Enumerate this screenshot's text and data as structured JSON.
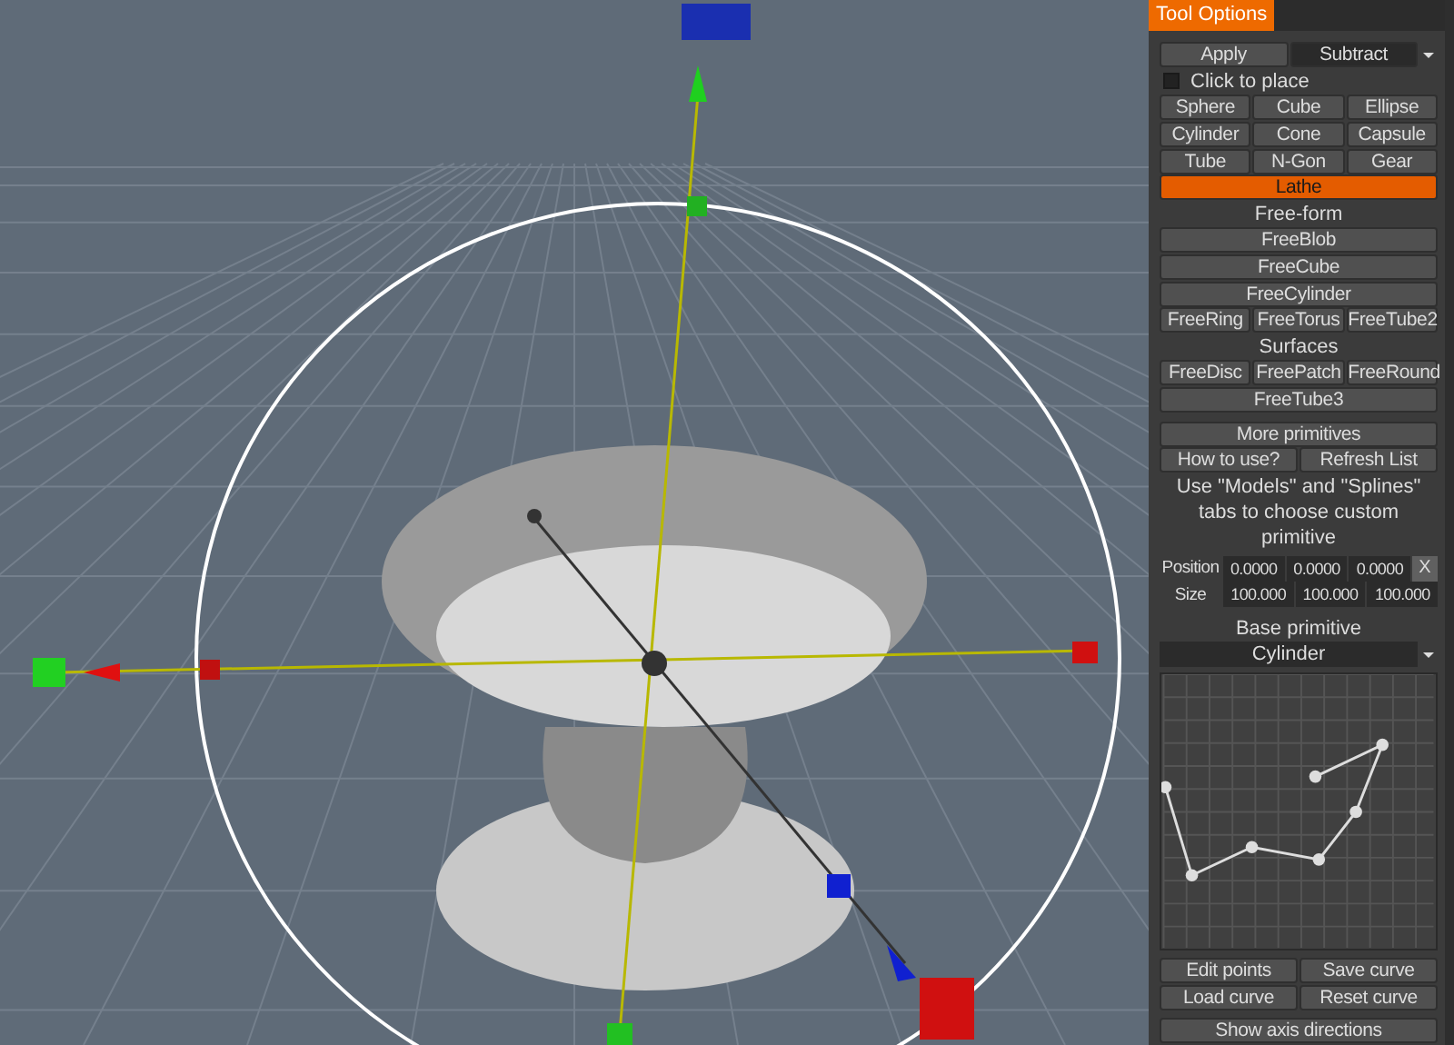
{
  "panel_tab": "Tool Options",
  "mode": {
    "options": [
      {
        "label": "Apply",
        "selected": false
      },
      {
        "label": "Subtract",
        "selected": true
      }
    ]
  },
  "click_to_place": {
    "label": "Click to place",
    "checked": false
  },
  "primitives": [
    {
      "kind": "grid",
      "buttons": [
        {
          "label": "Sphere",
          "selected": false
        },
        {
          "label": "Cube",
          "selected": false
        },
        {
          "label": "Ellipse",
          "selected": false
        }
      ]
    },
    {
      "kind": "grid",
      "buttons": [
        {
          "label": "Cylinder",
          "selected": false
        },
        {
          "label": "Cone",
          "selected": false
        },
        {
          "label": "Capsule",
          "selected": false
        }
      ]
    },
    {
      "kind": "grid",
      "buttons": [
        {
          "label": "Tube",
          "selected": false
        },
        {
          "label": "N-Gon",
          "selected": false
        },
        {
          "label": "Gear",
          "selected": false
        }
      ]
    },
    {
      "kind": "grid",
      "buttons": [
        {
          "label": "Lathe",
          "selected": true
        }
      ]
    },
    {
      "kind": "heading",
      "text": "Free-form"
    },
    {
      "kind": "grid",
      "buttons": [
        {
          "label": "FreeBlob",
          "selected": false
        }
      ]
    },
    {
      "kind": "grid",
      "buttons": [
        {
          "label": "FreeCube",
          "selected": false
        }
      ]
    },
    {
      "kind": "grid",
      "buttons": [
        {
          "label": "FreeCylinder",
          "selected": false
        }
      ]
    },
    {
      "kind": "grid",
      "buttons": [
        {
          "label": "FreeRing",
          "selected": false
        },
        {
          "label": "FreeTorus",
          "selected": false
        },
        {
          "label": "FreeTube2",
          "selected": false
        }
      ]
    },
    {
      "kind": "heading",
      "text": "Surfaces"
    },
    {
      "kind": "grid",
      "buttons": [
        {
          "label": "FreeDisc",
          "selected": false
        },
        {
          "label": "FreePatch",
          "selected": false
        },
        {
          "label": "FreeRound",
          "selected": false
        }
      ]
    },
    {
      "kind": "grid",
      "buttons": [
        {
          "label": "FreeTube3",
          "selected": false
        }
      ]
    }
  ],
  "more_button": "More primitives",
  "help_buttons": [
    "How to use?",
    "Refresh List"
  ],
  "help_text": "Use \"Models\" and \"Splines\" tabs to choose custom primitive",
  "position": {
    "label": "Position",
    "values": [
      "0.0000",
      "0.0000",
      "0.0000"
    ],
    "reset": "X"
  },
  "size": {
    "label": "Size",
    "values": [
      "100.000",
      "100.000",
      "100.000"
    ]
  },
  "base_primitive": {
    "label": "Base primitive",
    "value": "Cylinder"
  },
  "curve_buttons": [
    [
      "Edit points",
      "Save curve"
    ],
    [
      "Load curve",
      "Reset curve"
    ]
  ],
  "axis_button": "Show axis directions"
}
